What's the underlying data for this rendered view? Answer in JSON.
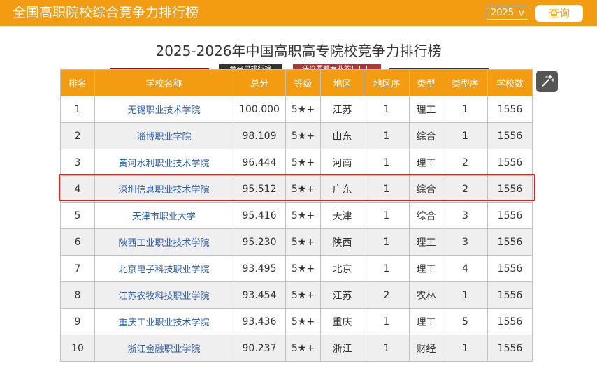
{
  "header": {
    "title": "全国高职院校综合竞争力排行榜",
    "year_value": "2025",
    "year_chevron": "V",
    "query_label": "查询"
  },
  "main": {
    "title": "2025-2026年中国高职高专院校竞争力排行榜",
    "badge_publisher": "金平果排行榜",
    "badge_slogan": "评价要看专业的！！！"
  },
  "table": {
    "headers": [
      "排名",
      "学校名称",
      "总分",
      "等级",
      "地区",
      "地区序",
      "类型",
      "类型序",
      "学校数"
    ],
    "rows": [
      [
        "1",
        "无锡职业技术学院",
        "100.000",
        "5★+",
        "江苏",
        "1",
        "理工",
        "1",
        "1556"
      ],
      [
        "2",
        "淄博职业学院",
        "98.109",
        "5★+",
        "山东",
        "1",
        "综合",
        "1",
        "1556"
      ],
      [
        "3",
        "黄河水利职业技术学院",
        "96.444",
        "5★+",
        "河南",
        "1",
        "理工",
        "2",
        "1556"
      ],
      [
        "4",
        "深圳信息职业技术学院",
        "95.512",
        "5★+",
        "广东",
        "1",
        "综合",
        "2",
        "1556"
      ],
      [
        "5",
        "天津市职业大学",
        "95.416",
        "5★+",
        "天津",
        "1",
        "综合",
        "3",
        "1556"
      ],
      [
        "6",
        "陕西工业职业技术学院",
        "95.230",
        "5★+",
        "陕西",
        "1",
        "理工",
        "3",
        "1556"
      ],
      [
        "7",
        "北京电子科技职业学院",
        "93.495",
        "5★+",
        "北京",
        "1",
        "理工",
        "4",
        "1556"
      ],
      [
        "8",
        "江苏农牧科技职业学院",
        "93.454",
        "5★+",
        "江苏",
        "2",
        "农林",
        "1",
        "1556"
      ],
      [
        "9",
        "重庆工业职业技术学院",
        "93.436",
        "5★+",
        "重庆",
        "1",
        "理工",
        "5",
        "1556"
      ],
      [
        "10",
        "浙江金融职业学院",
        "90.237",
        "5★+",
        "浙江",
        "1",
        "财经",
        "1",
        "1556"
      ]
    ]
  },
  "colors": {
    "accent": "#f39c12",
    "link": "#2a5db0",
    "highlight_border": "#e02020"
  },
  "icons": {
    "toolbar_tool": "magic-wand-icon"
  }
}
